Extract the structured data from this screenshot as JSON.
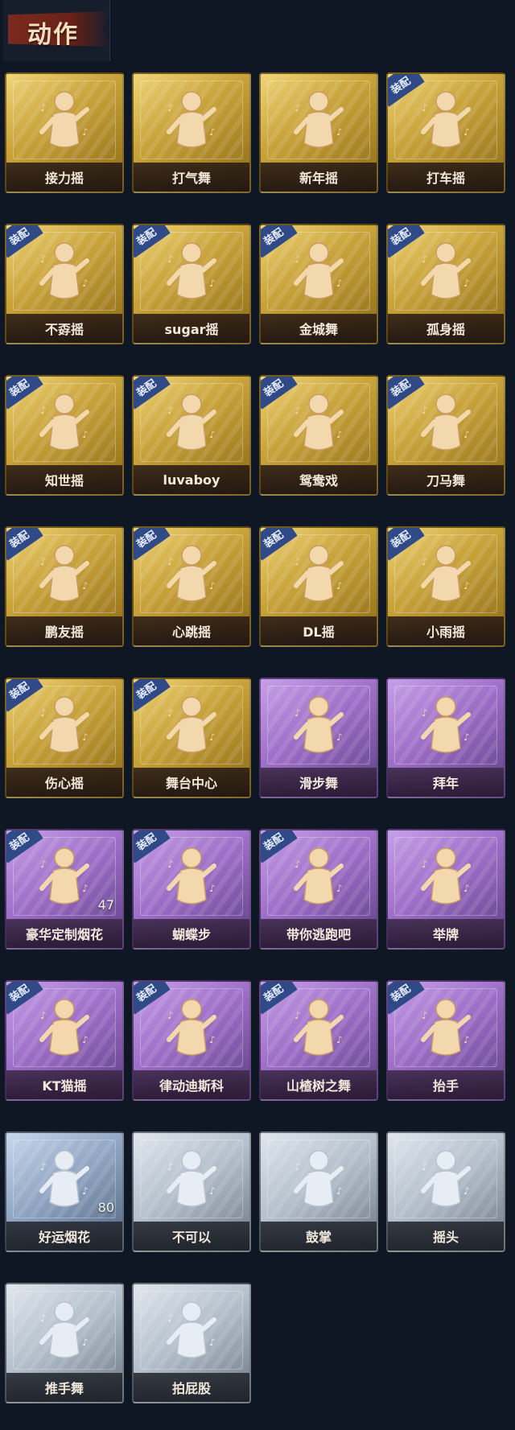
{
  "header": {
    "title": "动作"
  },
  "badge_text": "装配",
  "cards": [
    {
      "label": "接力摇",
      "tier": "gold",
      "equipped": false
    },
    {
      "label": "打气舞",
      "tier": "gold",
      "equipped": false
    },
    {
      "label": "新年摇",
      "tier": "gold",
      "equipped": false
    },
    {
      "label": "打车摇",
      "tier": "gold",
      "equipped": true
    },
    {
      "label": "不孬摇",
      "tier": "gold",
      "equipped": true
    },
    {
      "label": "sugar摇",
      "tier": "gold",
      "equipped": true
    },
    {
      "label": "金城舞",
      "tier": "gold",
      "equipped": true
    },
    {
      "label": "孤身摇",
      "tier": "gold",
      "equipped": true
    },
    {
      "label": "知世摇",
      "tier": "gold",
      "equipped": true
    },
    {
      "label": "luvaboy",
      "tier": "gold",
      "equipped": true
    },
    {
      "label": "鸳鸯戏",
      "tier": "gold",
      "equipped": true
    },
    {
      "label": "刀马舞",
      "tier": "gold",
      "equipped": true
    },
    {
      "label": "鹏友摇",
      "tier": "gold",
      "equipped": true
    },
    {
      "label": "心跳摇",
      "tier": "gold",
      "equipped": true
    },
    {
      "label": "DL摇",
      "tier": "gold",
      "equipped": true
    },
    {
      "label": "小雨摇",
      "tier": "gold",
      "equipped": true
    },
    {
      "label": "伤心摇",
      "tier": "gold",
      "equipped": true
    },
    {
      "label": "舞台中心",
      "tier": "gold",
      "equipped": true
    },
    {
      "label": "滑步舞",
      "tier": "purple",
      "equipped": false
    },
    {
      "label": "拜年",
      "tier": "purple",
      "equipped": false
    },
    {
      "label": "豪华定制烟花",
      "tier": "purple",
      "equipped": true,
      "count": "47"
    },
    {
      "label": "蝴蝶步",
      "tier": "purple",
      "equipped": true
    },
    {
      "label": "带你逃跑吧",
      "tier": "purple",
      "equipped": true
    },
    {
      "label": "举牌",
      "tier": "purple",
      "equipped": false
    },
    {
      "label": "KT猫摇",
      "tier": "purple",
      "equipped": true
    },
    {
      "label": "律动迪斯科",
      "tier": "purple",
      "equipped": true
    },
    {
      "label": "山楂树之舞",
      "tier": "purple",
      "equipped": true
    },
    {
      "label": "抬手",
      "tier": "purple",
      "equipped": true
    },
    {
      "label": "好运烟花",
      "tier": "blue",
      "equipped": false,
      "count": "80"
    },
    {
      "label": "不可以",
      "tier": "silver",
      "equipped": false
    },
    {
      "label": "鼓掌",
      "tier": "silver",
      "equipped": false
    },
    {
      "label": "摇头",
      "tier": "silver",
      "equipped": false
    },
    {
      "label": "推手舞",
      "tier": "silver",
      "equipped": false
    },
    {
      "label": "拍屁股",
      "tier": "silver",
      "equipped": false
    }
  ]
}
